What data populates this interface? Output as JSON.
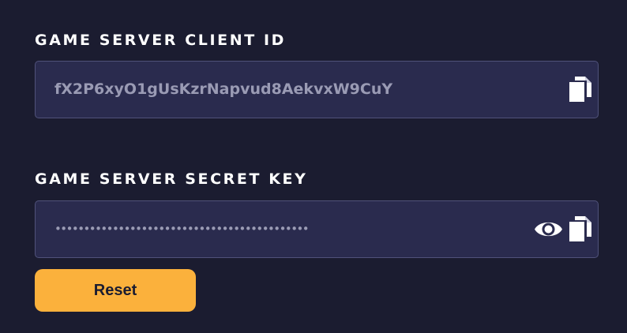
{
  "client_id": {
    "label": "GAME SERVER CLIENT ID",
    "value": "fX2P6xyO1gUsKzrNapvud8AekvxW9CuY",
    "copy_icon": "copy-icon"
  },
  "secret_key": {
    "label": "GAME SERVER SECRET KEY",
    "masked_value": "••••••••••••••••••••••••••••••••••••••••••••",
    "reveal_icon": "eye-icon",
    "copy_icon": "copy-icon"
  },
  "reset_button": {
    "label": "Reset"
  },
  "colors": {
    "background": "#1b1c30",
    "field_background": "#2a2b4e",
    "field_border": "#50527a",
    "field_text": "#9a9bb4",
    "label_text": "#ffffff",
    "accent": "#fbb13c"
  }
}
